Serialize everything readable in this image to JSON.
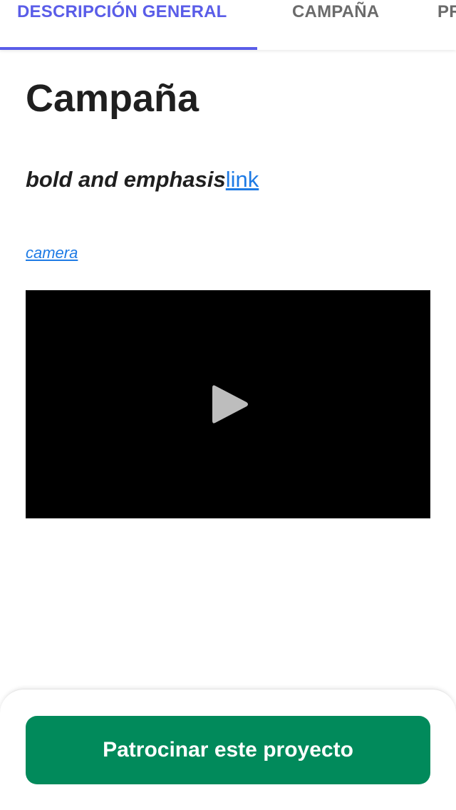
{
  "tabs": [
    {
      "label": "DESCRIPCIÓN GENERAL",
      "active": true
    },
    {
      "label": "CAMPAÑA",
      "active": false
    },
    {
      "label": "PR",
      "active": false
    }
  ],
  "content": {
    "heading": "Campaña",
    "bold_emphasis_text": "bold and emphasis",
    "inline_link_text": "link",
    "camera_link_text": "camera",
    "video": {
      "icon": "play-icon"
    }
  },
  "footer": {
    "sponsor_button_label": "Patrocinar este proyecto"
  },
  "colors": {
    "accent": "#5a5de8",
    "link": "#1e7be5",
    "primary_button": "#018a5b",
    "video_background": "#000000"
  }
}
